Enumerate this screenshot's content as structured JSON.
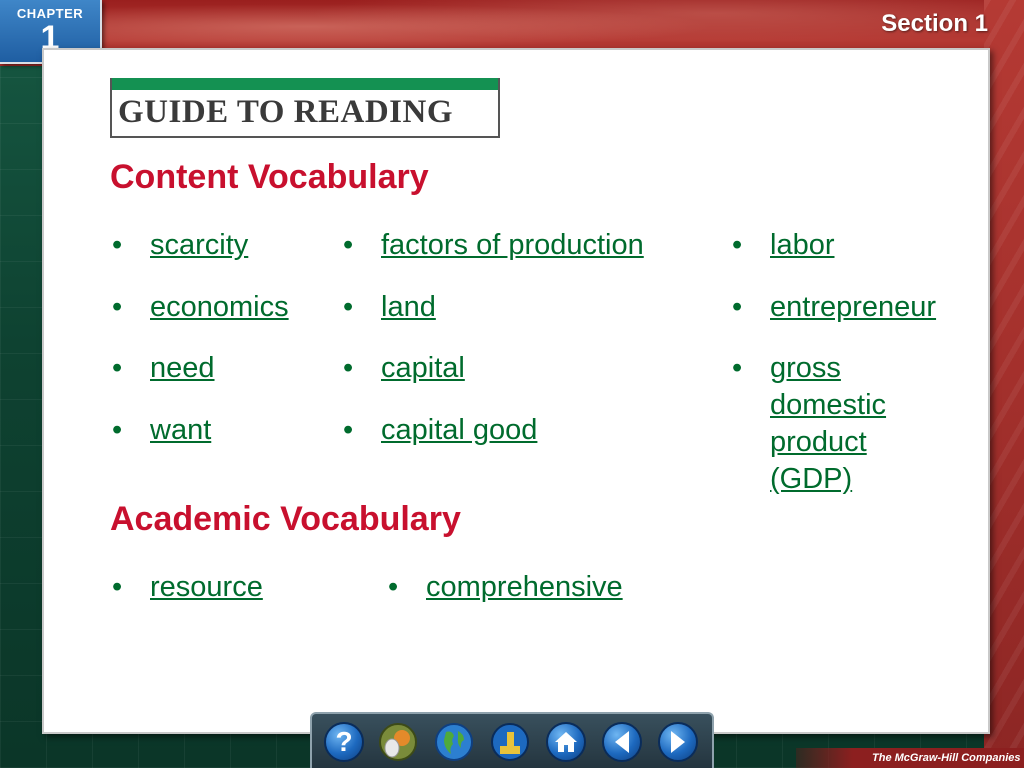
{
  "header": {
    "chapter_label": "CHAPTER",
    "chapter_number": "1",
    "section_label": "Section 1"
  },
  "guide_title": "GUIDE TO READING",
  "content_vocabulary": {
    "heading": "Content Vocabulary",
    "columns": [
      [
        "scarcity",
        "economics",
        "need",
        "want"
      ],
      [
        "factors of production",
        "land",
        "capital",
        "capital good"
      ],
      [
        "labor",
        "entrepreneur",
        "gross domestic product (GDP)"
      ]
    ]
  },
  "academic_vocabulary": {
    "heading": "Academic Vocabulary",
    "terms": [
      "resource",
      "comprehensive"
    ]
  },
  "bullet": "•",
  "toolbar": {
    "buttons": [
      "help-icon",
      "resources-icon",
      "globe-icon",
      "stamp-icon",
      "home-icon",
      "previous-arrow-icon",
      "next-arrow-icon"
    ]
  },
  "footer_brand": "The McGraw-Hill Companies",
  "colors": {
    "heading_red": "#c8102e",
    "vocab_green": "#006b2d",
    "guide_bar_green": "#149152",
    "chapter_blue": "#1f5ea2"
  }
}
